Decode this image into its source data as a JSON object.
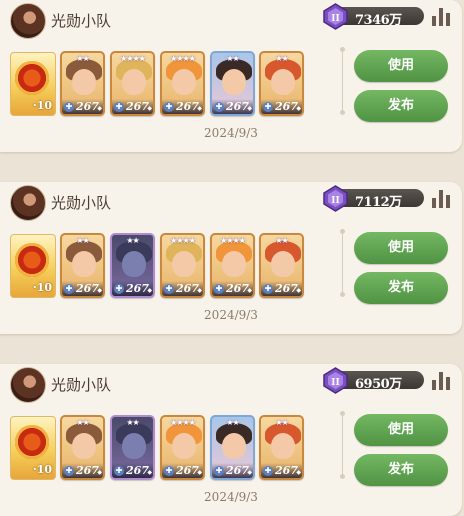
{
  "teams": [
    {
      "name": "光勋小队",
      "power": "7346万",
      "emblem_level": "10",
      "heroes": [
        {
          "stars": "★★",
          "level": "267",
          "hair": "#8a5a3a",
          "frame": "gold"
        },
        {
          "stars": "★★★★",
          "level": "267",
          "hair": "#e0b45a",
          "frame": "gold"
        },
        {
          "stars": "★★★★",
          "level": "267",
          "hair": "#f0953a",
          "frame": "gold"
        },
        {
          "stars": "★★",
          "level": "267",
          "hair": "#3a2a26",
          "frame": "blue"
        },
        {
          "stars": "★★",
          "level": "267",
          "hair": "#d8582e",
          "frame": "gold"
        }
      ],
      "date": "2024/9/3",
      "use_label": "使用",
      "publish_label": "发布"
    },
    {
      "name": "光勋小队",
      "power": "7112万",
      "emblem_level": "10",
      "heroes": [
        {
          "stars": "★★",
          "level": "267",
          "hair": "#8a5a3a",
          "frame": "gold"
        },
        {
          "stars": "★★",
          "level": "267",
          "hair": "#3a3a5a",
          "frame": "purple"
        },
        {
          "stars": "★★★★",
          "level": "267",
          "hair": "#e0b45a",
          "frame": "gold"
        },
        {
          "stars": "★★★★",
          "level": "267",
          "hair": "#f0953a",
          "frame": "gold"
        },
        {
          "stars": "★★",
          "level": "267",
          "hair": "#d8582e",
          "frame": "gold"
        }
      ],
      "date": "2024/9/3",
      "use_label": "使用",
      "publish_label": "发布"
    },
    {
      "name": "光勋小队",
      "power": "6950万",
      "emblem_level": "10",
      "heroes": [
        {
          "stars": "★★",
          "level": "267",
          "hair": "#8a5a3a",
          "frame": "gold"
        },
        {
          "stars": "★★",
          "level": "267",
          "hair": "#3a3a5a",
          "frame": "purple"
        },
        {
          "stars": "★★★★",
          "level": "267",
          "hair": "#f0953a",
          "frame": "gold"
        },
        {
          "stars": "★★",
          "level": "267",
          "hair": "#3a2a26",
          "frame": "blue"
        },
        {
          "stars": "★★",
          "level": "267",
          "hair": "#d8582e",
          "frame": "gold"
        }
      ],
      "date": "2024/9/3",
      "use_label": "使用",
      "publish_label": "发布"
    }
  ],
  "colors": {
    "button_green": "#5fa552",
    "background": "#ebe3d5",
    "card": "#f8f3ea"
  }
}
